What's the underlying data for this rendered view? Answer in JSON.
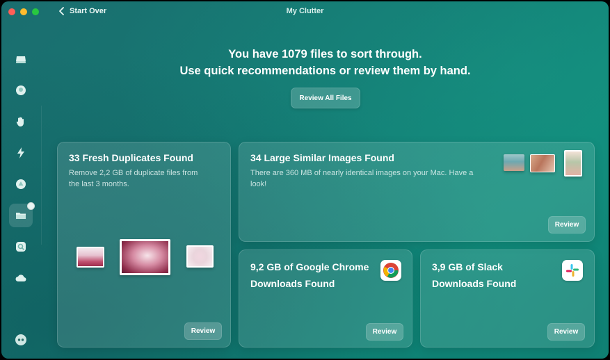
{
  "window": {
    "title": "My Clutter"
  },
  "nav": {
    "back_label": "Start Over"
  },
  "header": {
    "line1": "You have 1079 files to sort through.",
    "line2": "Use quick recommendations or review them by hand.",
    "review_all_label": "Review All Files"
  },
  "sidebar": {
    "items": [
      {
        "icon": "disk-icon"
      },
      {
        "icon": "shield-icon"
      },
      {
        "icon": "hand-icon"
      },
      {
        "icon": "bolt-icon"
      },
      {
        "icon": "apps-icon"
      },
      {
        "icon": "folder-icon",
        "active": true
      },
      {
        "icon": "search-icon"
      },
      {
        "icon": "cloud-icon"
      }
    ],
    "assistant_icon": "assistant-icon"
  },
  "cards": {
    "duplicates": {
      "title": "33 Fresh Duplicates Found",
      "desc_line1": "Remove 2,2 GB of duplicate files from",
      "desc_line2": "the last 3 months.",
      "review_label": "Review"
    },
    "similar": {
      "title": "34 Large Similar Images Found",
      "desc_line1": "There are 360 MB of nearly identical images on your Mac. Have a",
      "desc_line2": "look!",
      "review_label": "Review"
    },
    "chrome": {
      "title_line1": "9,2 GB of Google Chrome",
      "title_line2": "Downloads Found",
      "review_label": "Review"
    },
    "slack": {
      "title_line1": "3,9 GB of Slack",
      "title_line2": "Downloads Found",
      "review_label": "Review"
    }
  },
  "colors": {
    "accent": "#137a73",
    "chrome_red": "#db4437",
    "chrome_yellow": "#f4b400",
    "chrome_green": "#0f9d58",
    "chrome_blue": "#4285f4"
  }
}
